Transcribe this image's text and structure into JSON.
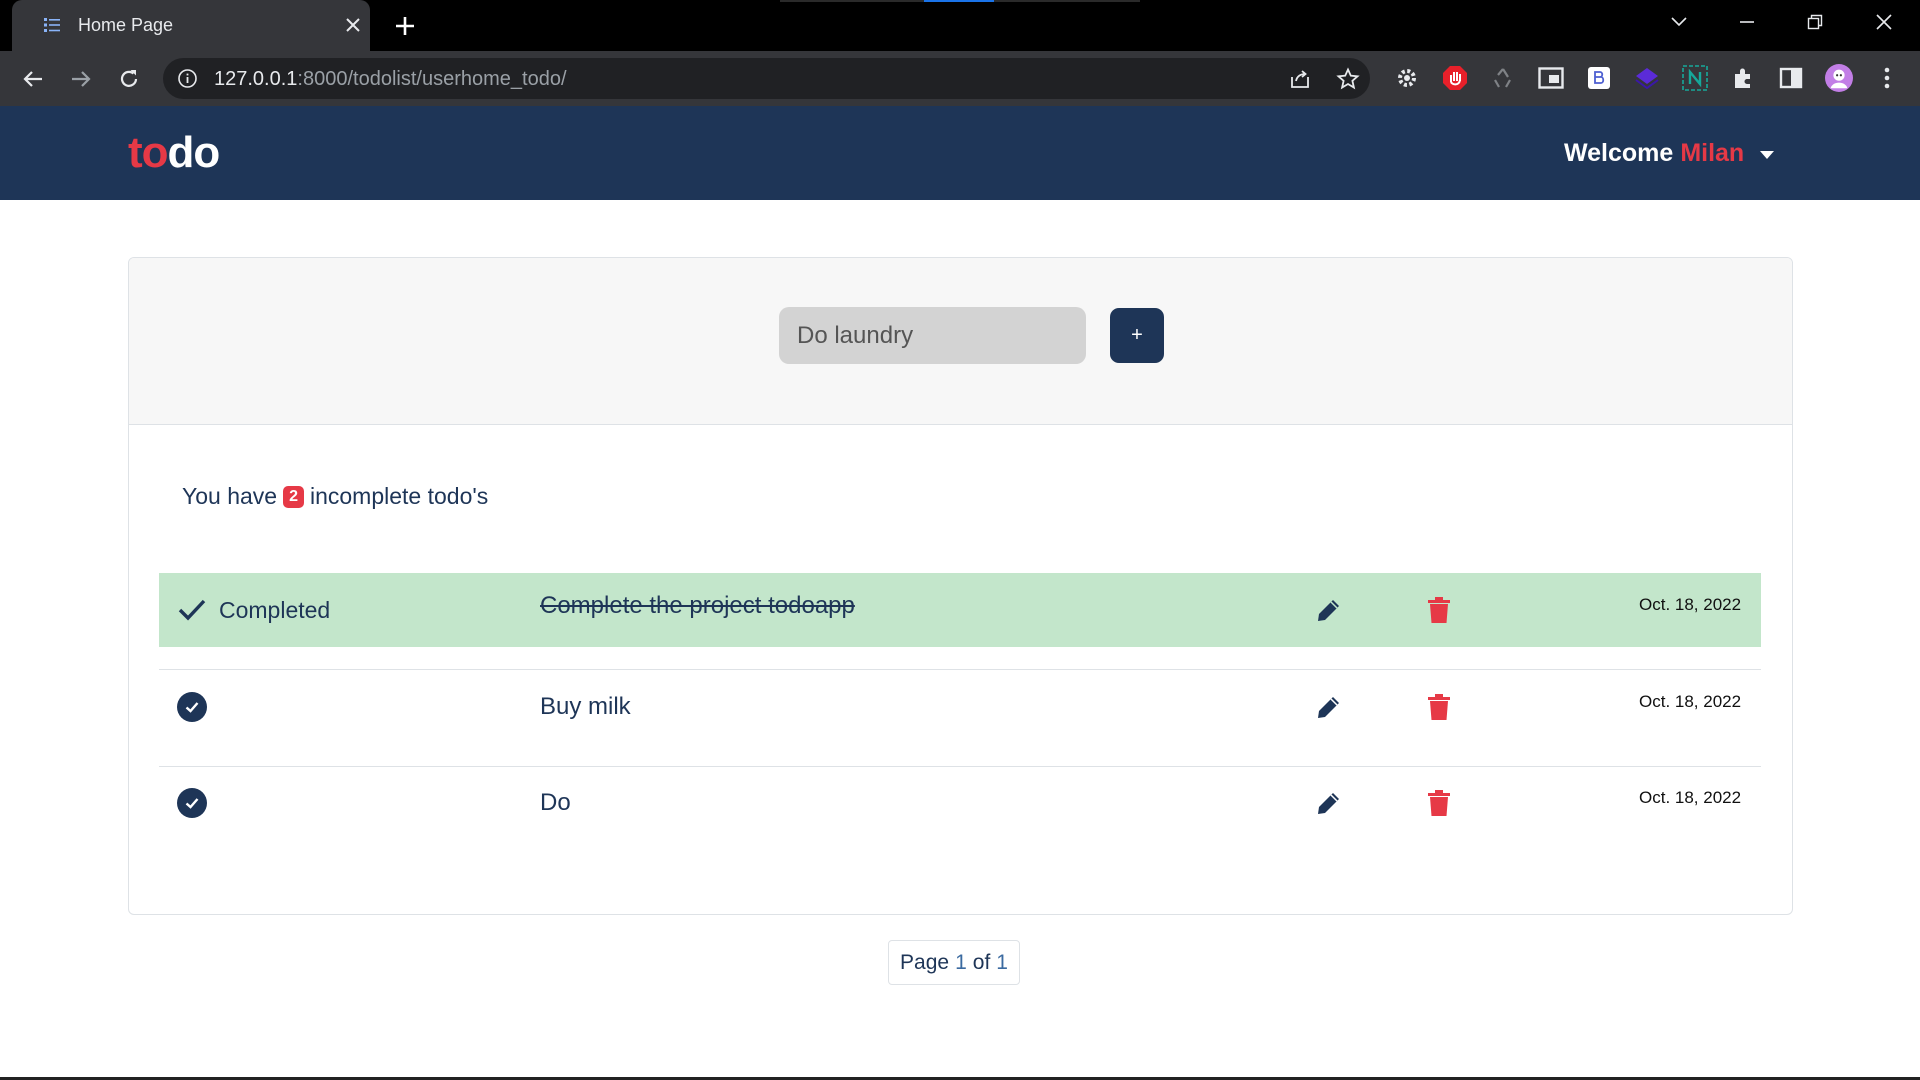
{
  "browser": {
    "tab_title": "Home Page",
    "url_host": "127.0.0.1",
    "url_rest": ":8000/todolist/userhome_todo/"
  },
  "navbar": {
    "brand_part1": "to",
    "brand_part2": "do",
    "welcome_label": "Welcome",
    "username": "Milan"
  },
  "form": {
    "input_value": "Do laundry",
    "add_label": "+"
  },
  "summary": {
    "prefix": "You have",
    "count": "2",
    "suffix": "incomplete todo's"
  },
  "todos": [
    {
      "status": "Completed",
      "title": "Complete the project todoapp",
      "date": "Oct. 18, 2022",
      "completed": true
    },
    {
      "status": "",
      "title": "Buy milk",
      "date": "Oct. 18, 2022",
      "completed": false
    },
    {
      "status": "",
      "title": "Do",
      "date": "Oct. 18, 2022",
      "completed": false
    }
  ],
  "pagination": {
    "page_label": "Page",
    "current": "1",
    "of_label": "of",
    "total": "1"
  },
  "colors": {
    "navbar_bg": "#1e3557",
    "accent_red": "#e63946",
    "completed_row_bg": "#c3e6cb",
    "card_header_bg": "#f7f7f7",
    "input_bg": "#d3d3d3"
  }
}
